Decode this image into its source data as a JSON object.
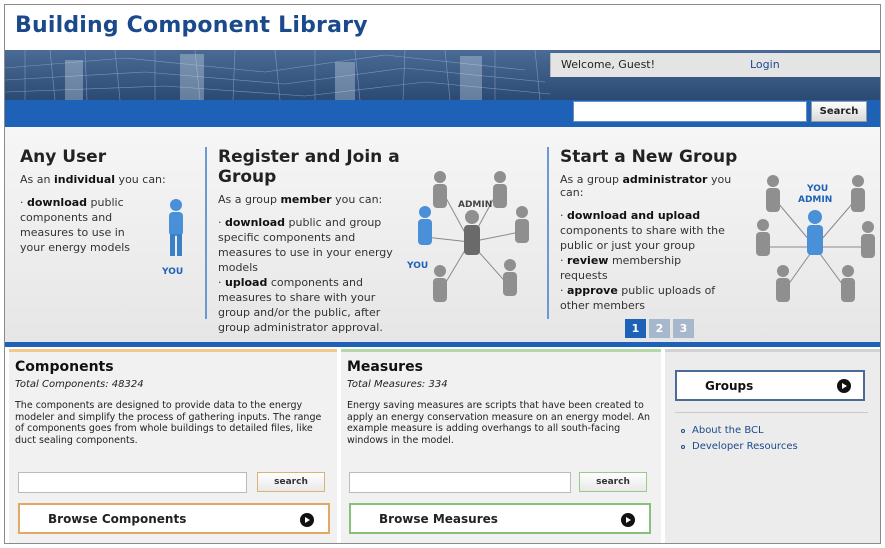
{
  "site": {
    "title": "Building Component Library"
  },
  "header": {
    "welcome": "Welcome, Guest!",
    "login": "Login",
    "search_button": "Search",
    "search_placeholder": ""
  },
  "hero": {
    "col1": {
      "title": "Any User",
      "lead_pre": "As an ",
      "lead_bold": "individual",
      "lead_post": " you can:",
      "items": [
        {
          "bold": "download",
          "text": " public components and measures to use in your energy models"
        }
      ],
      "figure_label": "YOU"
    },
    "col2": {
      "title": "Register and Join a Group",
      "lead_pre": "As a group ",
      "lead_bold": "member",
      "lead_post": " you can:",
      "items": [
        {
          "bold": "download",
          "text": " public and group specific components and measures to use in your energy models"
        },
        {
          "bold": "upload",
          "text": " components and measures to share with your group and/or the public, after group administrator approval."
        }
      ],
      "figure_label_you": "YOU",
      "figure_label_admin": "ADMIN"
    },
    "col3": {
      "title": "Start a New Group",
      "lead_pre": "As a group ",
      "lead_bold": "administrator",
      "lead_post": " you can:",
      "items": [
        {
          "bold": "download and upload",
          "text": " components to share with the public or just your group"
        },
        {
          "bold": "review",
          "text": " membership requests"
        },
        {
          "bold": "approve",
          "text": " public uploads of other members"
        }
      ],
      "figure_label_you": "YOU",
      "figure_label_admin": "ADMIN"
    },
    "pager": [
      "1",
      "2",
      "3"
    ],
    "active_page": 1
  },
  "components": {
    "title": "Components",
    "count": "Total Components: 48324",
    "description": "The components are designed to provide data to the energy modeler and simplify the process of gathering inputs. The range of components goes from whole buildings to detailed files, like duct sealing components.",
    "search_button": "search",
    "browse_button": "Browse Components",
    "accent": "#f1c98c"
  },
  "measures": {
    "title": "Measures",
    "count": "Total Measures: 334",
    "description": "Energy saving measures are scripts that have been created to apply an energy conservation measure on an energy model. An example measure is adding overhangs to all south-facing windows in the model.",
    "search_button": "search",
    "browse_button": "Browse Measures",
    "accent": "#b3d8a7"
  },
  "groups": {
    "button": "Groups",
    "links": [
      "About the BCL",
      "Developer Resources"
    ]
  },
  "colors": {
    "brand_blue": "#1d62b7",
    "title_blue": "#1a4a8c",
    "link_blue": "#1a4a8c"
  }
}
